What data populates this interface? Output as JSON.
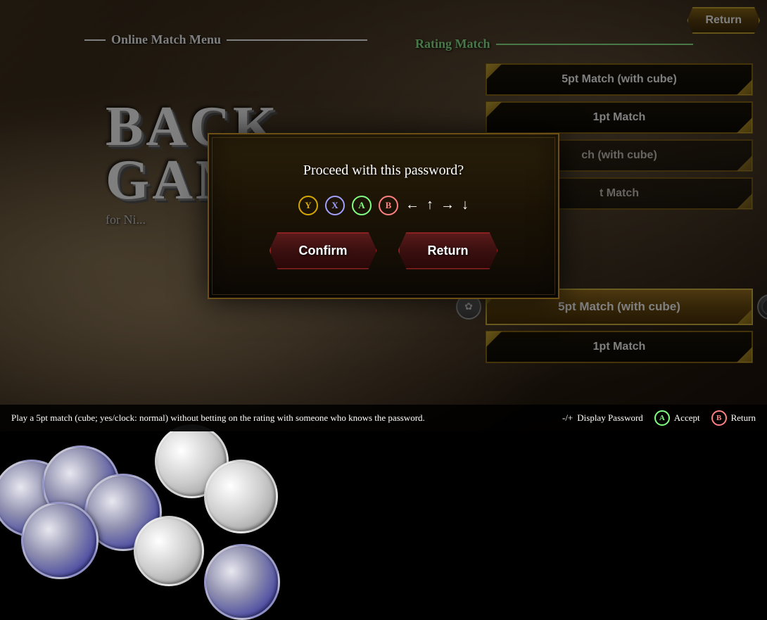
{
  "topBar": {
    "returnLabel": "Return"
  },
  "onlineMatch": {
    "menuTitle": "Online Match Menu"
  },
  "ratingMatch": {
    "title": "Rating Match"
  },
  "gameTitle": {
    "line1": "BACK",
    "line2": "GAM",
    "subtitle": "for Ni..."
  },
  "matchOptions": {
    "items": [
      {
        "label": "5pt Match (with cube)",
        "highlighted": false
      },
      {
        "label": "1pt Match",
        "highlighted": false
      },
      {
        "label": "ch (with cube)",
        "highlighted": false
      },
      {
        "label": "t Match",
        "highlighted": false
      }
    ],
    "highlighted": {
      "label": "5pt Match (with cube)"
    },
    "bottom": {
      "label": "1pt Match"
    }
  },
  "dialog": {
    "question": "Proceed with this password?",
    "passwordSymbols": [
      "Y",
      "X",
      "A",
      "B",
      "←",
      "↑",
      "→",
      "↓"
    ],
    "confirmLabel": "Confirm",
    "returnLabel": "Return"
  },
  "statusBar": {
    "helpText": "Play a 5pt match (cube; yes/clock: normal) without betting on the rating with someone who knows the password.",
    "controls": [
      {
        "symbol": "-/+",
        "label": "Display Password"
      },
      {
        "symbol": "A",
        "label": "Accept"
      },
      {
        "symbol": "B",
        "label": "Return"
      }
    ]
  }
}
